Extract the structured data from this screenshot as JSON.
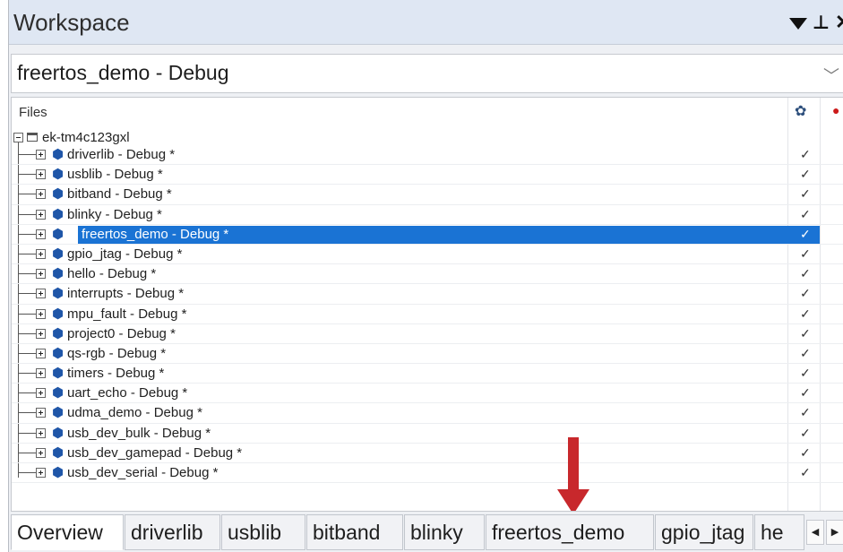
{
  "window": {
    "title": "Workspace",
    "title_icons": [
      "menu-triangle-icon",
      "pin-icon",
      "close-icon"
    ]
  },
  "configuration": {
    "value": "freertos_demo - Debug"
  },
  "tree": {
    "header": "Files",
    "header_icons": [
      "gear-icon",
      "red-dot-icon"
    ],
    "root": "ek-tm4c123gxl",
    "items": [
      {
        "label": "driverlib - Debug *",
        "check": "✓"
      },
      {
        "label": "usblib - Debug *",
        "check": "✓"
      },
      {
        "label": "bitband - Debug *",
        "check": "✓"
      },
      {
        "label": "blinky - Debug *",
        "check": "✓"
      },
      {
        "label": "freertos_demo - Debug *",
        "check": "✓",
        "selected": true
      },
      {
        "label": "gpio_jtag - Debug *",
        "check": "✓"
      },
      {
        "label": "hello - Debug *",
        "check": "✓"
      },
      {
        "label": "interrupts - Debug *",
        "check": "✓"
      },
      {
        "label": "mpu_fault - Debug *",
        "check": "✓"
      },
      {
        "label": "project0 - Debug *",
        "check": "✓"
      },
      {
        "label": "qs-rgb - Debug *",
        "check": "✓"
      },
      {
        "label": "timers - Debug *",
        "check": "✓"
      },
      {
        "label": "uart_echo - Debug *",
        "check": "✓"
      },
      {
        "label": "udma_demo - Debug *",
        "check": "✓"
      },
      {
        "label": "usb_dev_bulk - Debug *",
        "check": "✓"
      },
      {
        "label": "usb_dev_gamepad - Debug *",
        "check": "✓"
      },
      {
        "label": "usb_dev_serial - Debug *",
        "check": "✓"
      }
    ]
  },
  "tabs": {
    "items": [
      "Overview",
      "driverlib",
      "usblib",
      "bitband",
      "blinky",
      "freertos_demo",
      "gpio_jtag",
      "he"
    ],
    "active": "Overview",
    "nav_left": "◀",
    "nav_right": "▶"
  },
  "colors": {
    "selection": "#1a73d4",
    "arrow": "#c8282c",
    "project_icon": "#1f56a8",
    "titlebar": "#dfe7f3"
  }
}
